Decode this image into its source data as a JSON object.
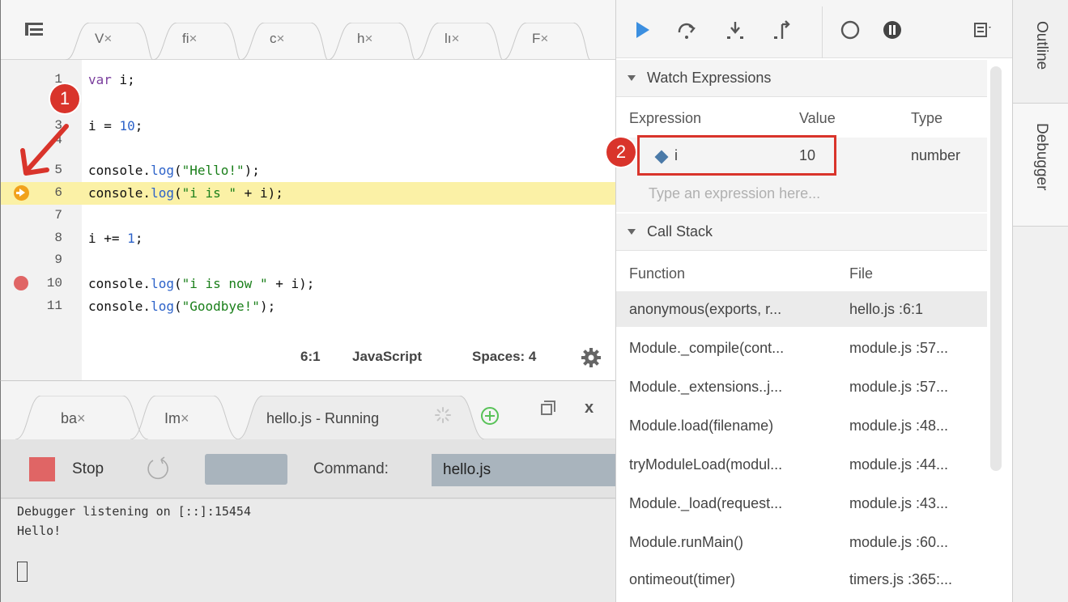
{
  "editor": {
    "tabs": [
      {
        "label": "V",
        "close": "×"
      },
      {
        "label": "fi",
        "close": "×"
      },
      {
        "label": "c",
        "close": "×"
      },
      {
        "label": "h",
        "close": "×"
      },
      {
        "label": "lı",
        "close": "×"
      },
      {
        "label": "F",
        "close": "×"
      }
    ],
    "line_numbers": [
      "1",
      "3",
      "4",
      "5",
      "6",
      "7",
      "8",
      "9",
      "10",
      "11"
    ],
    "code": {
      "l1_kw": "var",
      "l1_rest": " i;",
      "l3_pre": "i = ",
      "l3_num": "10",
      "l3_post": ";",
      "l5_pre": "console.",
      "l5_fn": "log",
      "l5_open": "(",
      "l5_str": "\"Hello!\"",
      "l5_close": ");",
      "l6_pre": "console.",
      "l6_fn": "log",
      "l6_open": "(",
      "l6_str": "\"i is \"",
      "l6_close": " + i);",
      "l8_pre": "i += ",
      "l8_num": "1",
      "l8_post": ";",
      "l10_pre": "console.",
      "l10_fn": "log",
      "l10_open": "(",
      "l10_str": "\"i is now \"",
      "l10_close": " + i);",
      "l11_pre": "console.",
      "l11_fn": "log",
      "l11_open": "(",
      "l11_str": "\"Goodbye!\"",
      "l11_close": ");"
    },
    "status": {
      "cursor": "6:1",
      "language": "JavaScript",
      "spaces": "Spaces: 4"
    }
  },
  "bottom": {
    "tabs": [
      {
        "label": "ba",
        "close": "×"
      },
      {
        "label": "Im",
        "close": "×"
      },
      {
        "label": "hello.js - Running"
      }
    ],
    "close_label": "x",
    "stop_label": "Stop",
    "command_label": "Command:",
    "command_value": "hello.js",
    "console_lines": [
      "Debugger listening on [::]:15454",
      "Hello!"
    ]
  },
  "debugger": {
    "watch": {
      "title": "Watch Expressions",
      "headers": {
        "expression": "Expression",
        "value": "Value",
        "type": "Type"
      },
      "rows": [
        {
          "expression": "i",
          "value": "10",
          "type": "number"
        }
      ],
      "placeholder": "Type an expression here..."
    },
    "callstack": {
      "title": "Call Stack",
      "headers": {
        "function": "Function",
        "file": "File"
      },
      "rows": [
        {
          "function": "anonymous(exports, r...",
          "file": "hello.js :6:1"
        },
        {
          "function": "Module._compile(cont...",
          "file": "module.js :57..."
        },
        {
          "function": "Module._extensions..j...",
          "file": "module.js :57..."
        },
        {
          "function": "Module.load(filename)",
          "file": "module.js :48..."
        },
        {
          "function": "tryModuleLoad(modul...",
          "file": "module.js :44..."
        },
        {
          "function": "Module._load(request...",
          "file": "module.js :43..."
        },
        {
          "function": "Module.runMain()",
          "file": "module.js :60..."
        },
        {
          "function": "ontimeout(timer)",
          "file": "timers.js :365:..."
        }
      ]
    }
  },
  "side_tabs": [
    "Outline",
    "Debugger"
  ],
  "annotations": [
    "1",
    "2"
  ],
  "colors": {
    "breakpoint": "#e06565",
    "exec_arrow": "#f1a21c",
    "line_highlight": "#fbf1a6",
    "annotation_red": "#d9342b",
    "resume_blue": "#3c8fe0"
  }
}
